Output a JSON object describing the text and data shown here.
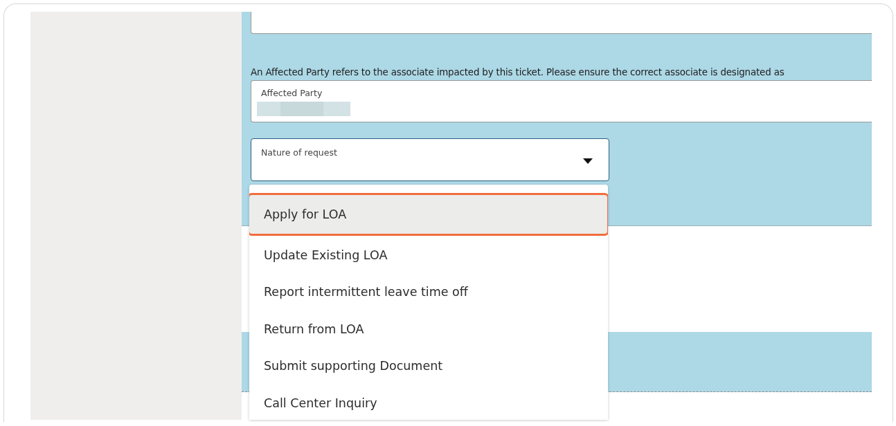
{
  "form": {
    "notice": "An Affected Party refers to the associate impacted by this ticket. Please ensure the correct associate is designated as",
    "affected_party": {
      "label": "Affected Party"
    },
    "nature_of_request": {
      "label": "Nature of request",
      "expanded": true,
      "options": [
        {
          "label": "Apply for LOA",
          "selected": true
        },
        {
          "label": "Update Existing LOA",
          "selected": false
        },
        {
          "label": "Report intermittent leave time off",
          "selected": false
        },
        {
          "label": "Return from LOA",
          "selected": false
        },
        {
          "label": "Submit supporting Document",
          "selected": false
        },
        {
          "label": "Call Center Inquiry",
          "selected": false
        }
      ]
    }
  }
}
